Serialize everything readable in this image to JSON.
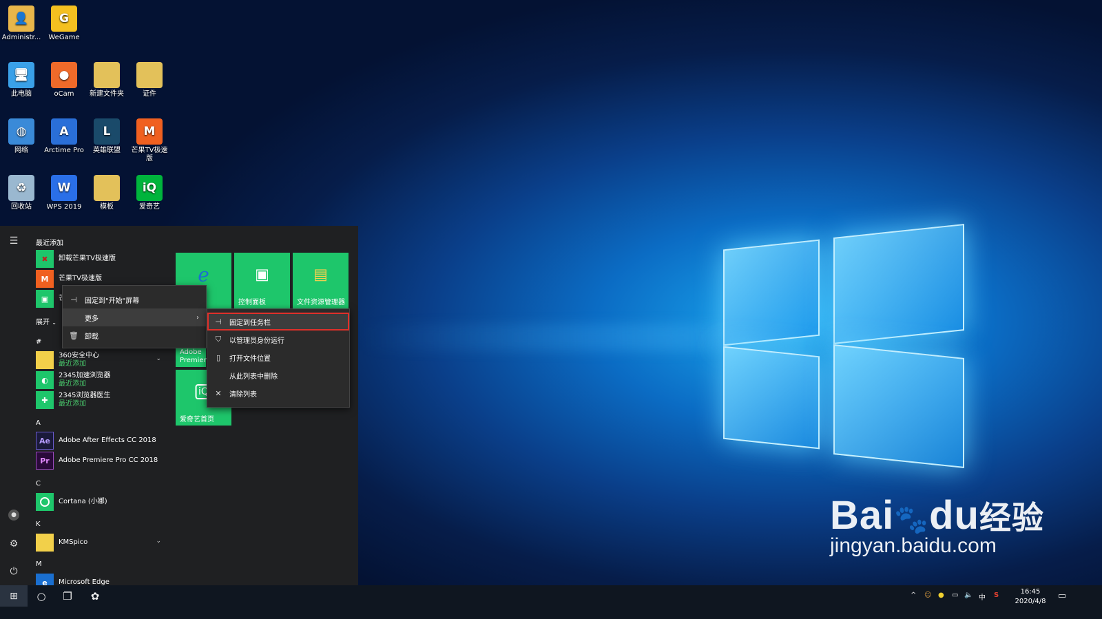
{
  "desktop_icons": [
    {
      "label": "Administr...",
      "icon": "user-folder-icon",
      "color": "#e8b64a"
    },
    {
      "label": "WeGame",
      "icon": "wegame-icon",
      "color": "#f4c020"
    },
    {
      "label": "此电脑",
      "icon": "computer-icon",
      "color": "#3aa0e8"
    },
    {
      "label": "oCam",
      "icon": "ocam-icon",
      "color": "#ef6a2a"
    },
    {
      "label": "新建文件夹",
      "icon": "folder-icon",
      "color": "#e3c15a"
    },
    {
      "label": "证件",
      "icon": "folder-icon",
      "color": "#e3c15a"
    },
    {
      "label": "网络",
      "icon": "network-icon",
      "color": "#3a8ad8"
    },
    {
      "label": "Arctime Pro",
      "icon": "arctime-icon",
      "color": "#2a6fd8"
    },
    {
      "label": "英雄联盟",
      "icon": "lol-icon",
      "color": "#1a4a6a"
    },
    {
      "label": "芒果TV极速版",
      "icon": "mgtv-icon",
      "color": "#f06020"
    },
    {
      "label": "回收站",
      "icon": "recycle-bin-icon",
      "color": "#9ab8d0"
    },
    {
      "label": "WPS 2019",
      "icon": "wps-icon",
      "color": "#2a6fe8"
    },
    {
      "label": "模板",
      "icon": "folder-icon",
      "color": "#e3c15a"
    },
    {
      "label": "爱奇艺",
      "icon": "iqiyi-icon",
      "color": "#00b43c"
    }
  ],
  "start_menu": {
    "recent_header": "最近添加",
    "recent": [
      {
        "label": "卸载芒果TV极速版",
        "icon": "mgtv-uninstall-icon",
        "color": "#1ec66b"
      },
      {
        "label": "芒果TV极速版",
        "icon": "mgtv-icon",
        "color": "#f06020"
      },
      {
        "label": "芒",
        "icon": "app-icon",
        "color": "#1ec66b"
      }
    ],
    "expand_label": "展开",
    "groups": [
      {
        "letter": "#",
        "apps": [
          {
            "label": "360安全中心",
            "sub": "最近添加",
            "color": "#f2d04a"
          },
          {
            "label": "2345加速浏览器",
            "sub": "最近添加",
            "color": "#1ec66b"
          },
          {
            "label": "2345浏览器医生",
            "sub": "最近添加",
            "color": "#1ec66b"
          }
        ]
      },
      {
        "letter": "A",
        "apps": [
          {
            "label": "Adobe After Effects CC 2018",
            "glyph": "Ae",
            "color": "#1a1a3a"
          },
          {
            "label": "Adobe Premiere Pro CC 2018",
            "glyph": "Pr",
            "color": "#2a0a3a"
          }
        ]
      },
      {
        "letter": "C",
        "apps": [
          {
            "label": "Cortana (小娜)",
            "color": "#1ec66b"
          }
        ]
      },
      {
        "letter": "K",
        "apps": [
          {
            "label": "KMSpico",
            "color": "#f2d04a"
          }
        ]
      },
      {
        "letter": "M",
        "apps": [
          {
            "label": "Microsoft Edge",
            "color": "#1a6fd0"
          }
        ]
      }
    ],
    "tiles": [
      {
        "label": "",
        "icon": "edge-icon",
        "glyph": "e"
      },
      {
        "label": "控制面板",
        "icon": "control-panel-icon",
        "glyph": "▣"
      },
      {
        "label": "文件资源管理器",
        "icon": "file-explorer-icon",
        "glyph": "▤"
      },
      {
        "label": "Adobe Premiere",
        "icon": "premiere-icon",
        "glyph": ""
      },
      {
        "label": "爱奇艺首页",
        "icon": "iqiyi-icon",
        "glyph": "iQ"
      }
    ]
  },
  "context_menu": {
    "items": [
      "固定到\"开始\"屏幕",
      "更多",
      "卸载"
    ]
  },
  "submenu": {
    "items": [
      "固定到任务栏",
      "以管理员身份运行",
      "打开文件位置",
      "从此列表中删除",
      "清除列表"
    ]
  },
  "taskbar": {
    "time": "16:45",
    "date": "2020/4/8",
    "ime": "中"
  },
  "watermark": {
    "brand": "Bai",
    "brand2": "du",
    "cn": "经验",
    "url": "jingyan.baidu.com"
  }
}
